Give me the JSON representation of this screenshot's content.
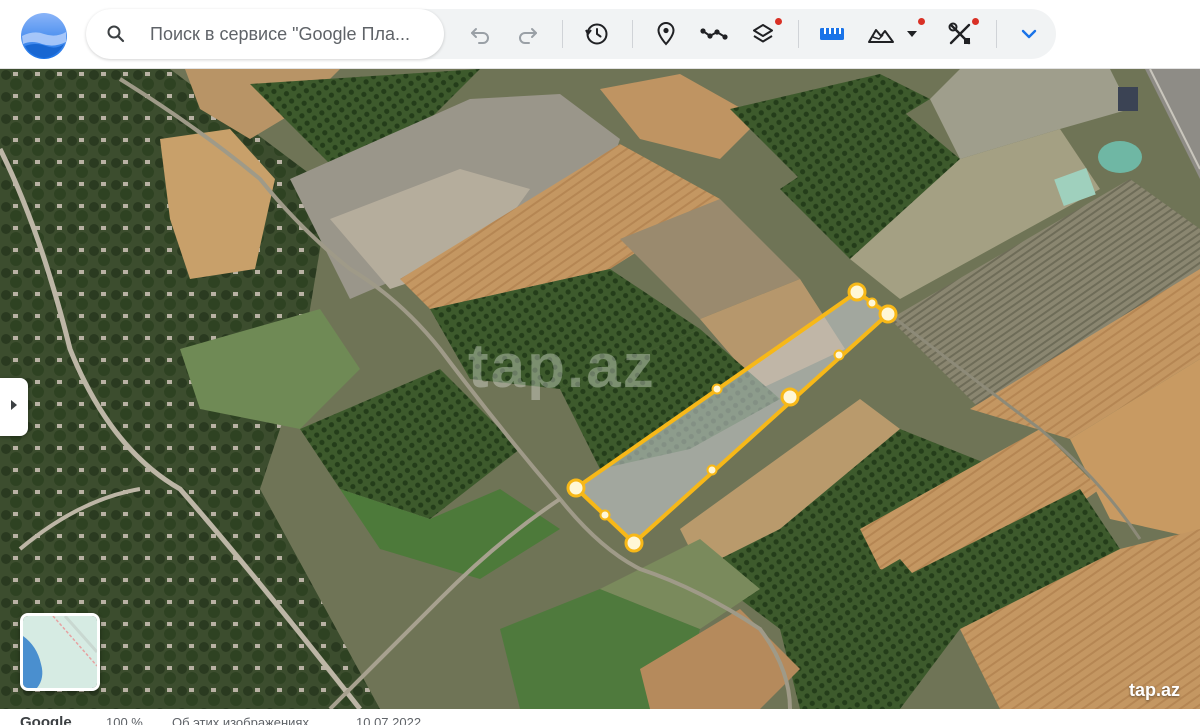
{
  "toolbar": {
    "search_placeholder": "Поиск в сервисе \"Google Пла...",
    "icons": [
      "google-earth-logo",
      "search-icon",
      "undo-icon",
      "redo-icon",
      "history-icon",
      "placemark-icon",
      "path-icon",
      "layers-icon",
      "ruler-icon",
      "terrain-icon",
      "tools-icon",
      "chevron-down-icon"
    ],
    "notification_dot_color": "#d93025"
  },
  "map": {
    "watermark": "tap.az",
    "corner_watermark": "tap.az",
    "polygon_color": "#f7b818"
  },
  "statusbar": {
    "brand": "Google",
    "zoom": "100 %",
    "image_info": "Об этих изображениях",
    "date": "10.07.2022"
  }
}
